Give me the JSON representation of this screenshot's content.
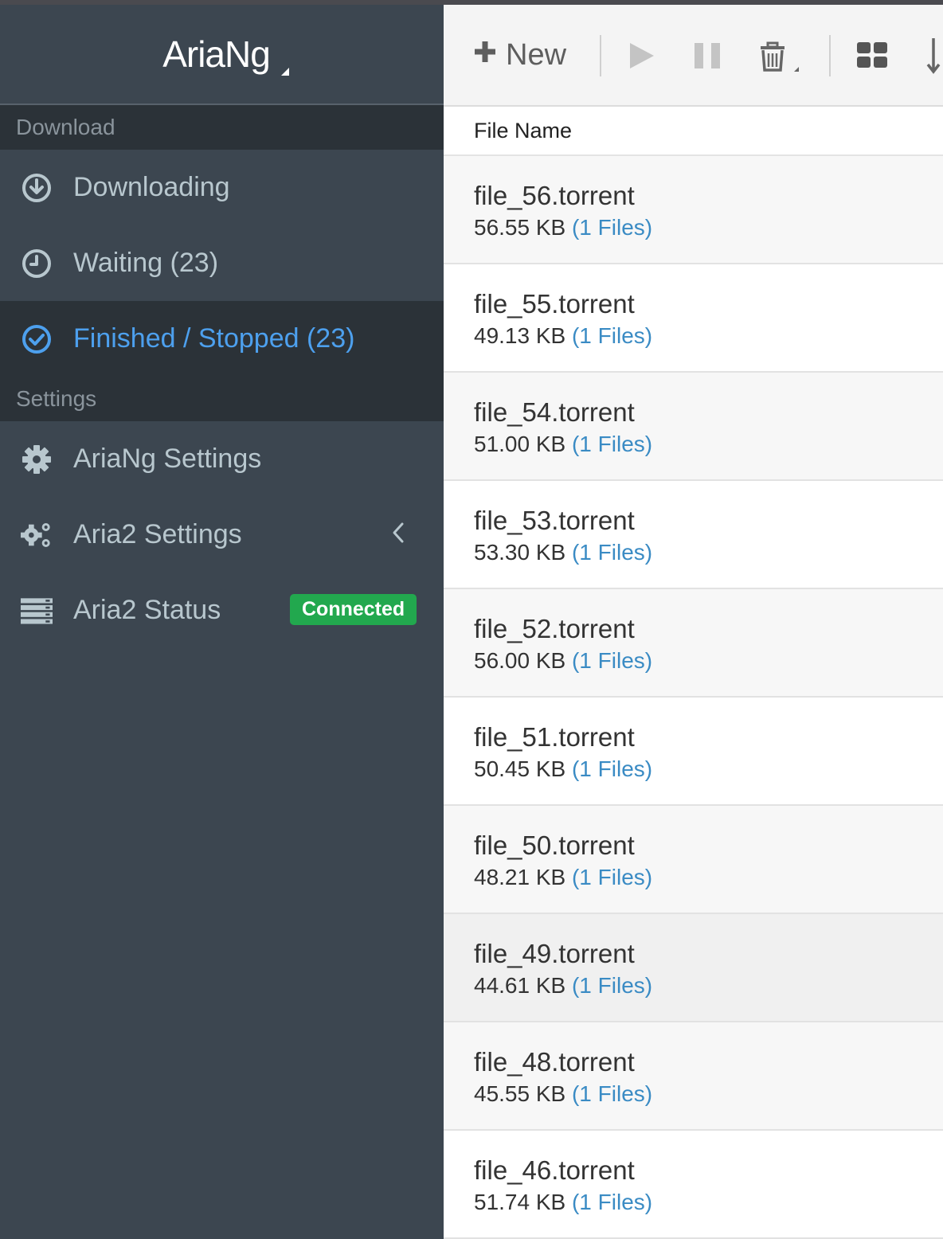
{
  "app": {
    "title": "AriaNg"
  },
  "sidebar": {
    "download_header": "Download",
    "settings_header": "Settings",
    "items": [
      {
        "label": "Downloading",
        "icon": "download-circle-icon",
        "active": false
      },
      {
        "label": "Waiting (23)",
        "icon": "clock-icon",
        "active": false
      },
      {
        "label": "Finished / Stopped (23)",
        "icon": "check-circle-icon",
        "active": true
      }
    ],
    "settings_items": [
      {
        "label": "AriaNg Settings",
        "icon": "gear-icon"
      },
      {
        "label": "Aria2 Settings",
        "icon": "gears-icon"
      },
      {
        "label": "Aria2 Status",
        "icon": "server-icon",
        "badge": "Connected"
      }
    ]
  },
  "toolbar": {
    "new_label": "New"
  },
  "table": {
    "column_header": "File Name",
    "rows": [
      {
        "name": "file_56.torrent",
        "size": "56.55 KB",
        "files": "(1 Files)"
      },
      {
        "name": "file_55.torrent",
        "size": "49.13 KB",
        "files": "(1 Files)"
      },
      {
        "name": "file_54.torrent",
        "size": "51.00 KB",
        "files": "(1 Files)"
      },
      {
        "name": "file_53.torrent",
        "size": "53.30 KB",
        "files": "(1 Files)"
      },
      {
        "name": "file_52.torrent",
        "size": "56.00 KB",
        "files": "(1 Files)"
      },
      {
        "name": "file_51.torrent",
        "size": "50.45 KB",
        "files": "(1 Files)"
      },
      {
        "name": "file_50.torrent",
        "size": "48.21 KB",
        "files": "(1 Files)"
      },
      {
        "name": "file_49.torrent",
        "size": "44.61 KB",
        "files": "(1 Files)"
      },
      {
        "name": "file_48.torrent",
        "size": "45.55 KB",
        "files": "(1 Files)"
      },
      {
        "name": "file_46.torrent",
        "size": "51.74 KB",
        "files": "(1 Files)"
      }
    ]
  },
  "colors": {
    "sidebar_bg": "#3c4650",
    "active_accent": "#4da0ee",
    "badge_green": "#22a84e",
    "link_blue": "#3a8bc4"
  }
}
